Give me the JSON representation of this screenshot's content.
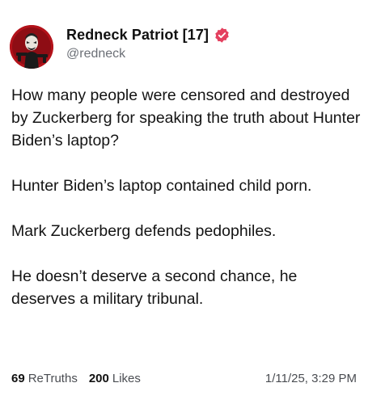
{
  "user": {
    "display_name": "Redneck Patriot [17]",
    "handle": "@redneck",
    "verified_icon": "verified-badge-icon",
    "accent_color": "#e4405f"
  },
  "post": {
    "paragraphs": [
      "How many people were censored and destroyed by Zuckerberg for speaking the truth about Hunter Biden’s laptop?",
      "Hunter Biden’s laptop contained child porn.",
      "Mark Zuckerberg defends pedophiles.",
      "He doesn’t deserve a second chance, he deserves a military tribunal."
    ]
  },
  "stats": {
    "retruths_count": "69",
    "retruths_label": "ReTruths",
    "likes_count": "200",
    "likes_label": "Likes"
  },
  "timestamp": "1/11/25, 3:29 PM"
}
